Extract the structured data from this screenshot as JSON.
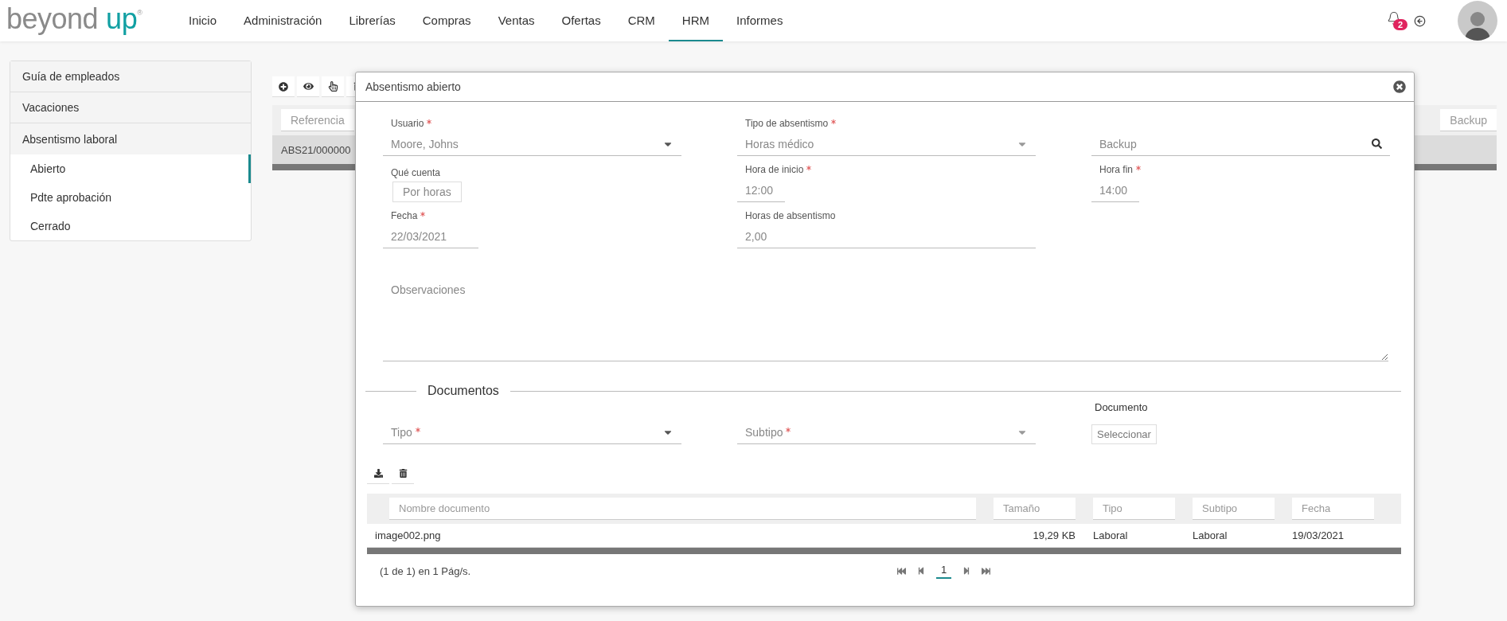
{
  "nav": {
    "logo": {
      "word": "beyond",
      "accent": "up",
      "mark": "®"
    },
    "menu": [
      {
        "label": "Inicio",
        "selected": false
      },
      {
        "label": "Administración",
        "selected": false
      },
      {
        "label": "Librerías",
        "selected": false
      },
      {
        "label": "Compras",
        "selected": false
      },
      {
        "label": "Ventas",
        "selected": false
      },
      {
        "label": "Ofertas",
        "selected": false
      },
      {
        "label": "CRM",
        "selected": false
      },
      {
        "label": "HRM",
        "selected": true
      },
      {
        "label": "Informes",
        "selected": false
      }
    ],
    "notifications": {
      "count": "2"
    }
  },
  "sidebar": {
    "items": [
      {
        "label": "Guía de empleados",
        "expanded": false
      },
      {
        "label": "Vacaciones",
        "expanded": false
      },
      {
        "label": "Absentismo laboral",
        "expanded": true,
        "children": [
          {
            "label": "Abierto",
            "selected": true
          },
          {
            "label": "Pdte aprobación",
            "selected": false
          },
          {
            "label": "Cerrado",
            "selected": false
          }
        ]
      }
    ]
  },
  "background_table": {
    "columns": [
      "Referencia",
      "Backup"
    ],
    "rows": [
      [
        "ABS21/000000"
      ]
    ]
  },
  "dialog": {
    "title": "Absentismo abierto",
    "fields": [
      {
        "kind": "select",
        "label": "Usuario",
        "required": true,
        "value": "Moore, Johns"
      },
      {
        "kind": "select",
        "label": "Tipo de absentismo",
        "required": true,
        "value": "Horas médico"
      },
      {
        "kind": "search",
        "placeholder": "Backup"
      },
      {
        "kind": "toggle",
        "label": "Qué cuenta",
        "value": "Por horas"
      },
      {
        "kind": "short",
        "label": "Hora de inicio",
        "required": true,
        "value": "12:00"
      },
      {
        "kind": "short",
        "label": "Hora fin",
        "required": true,
        "value": "14:00"
      },
      {
        "kind": "date",
        "label": "Fecha",
        "required": true,
        "value": "22/03/2021"
      },
      {
        "kind": "input",
        "label": "Horas de absentismo",
        "required": false,
        "value": "2,00"
      }
    ],
    "notes": {
      "placeholder": "Observaciones"
    },
    "documents": {
      "title": "Documentos",
      "fields": [
        {
          "kind": "select",
          "placeholder": "Tipo",
          "required": true
        },
        {
          "kind": "select",
          "placeholder": "Subtipo",
          "required": true
        },
        {
          "kind": "file",
          "label": "Documento",
          "button": "Seleccionar"
        }
      ],
      "table": {
        "columns": [
          "Nombre documento",
          "Tamaño",
          "Tipo",
          "Subtipo",
          "Fecha"
        ],
        "rows": [
          [
            "image002.png",
            "19,29 KB",
            "Laboral",
            "Laboral",
            "19/03/2021"
          ]
        ]
      },
      "footer": "(1 de 1) en 1 Pág/s.",
      "page": "1"
    }
  }
}
